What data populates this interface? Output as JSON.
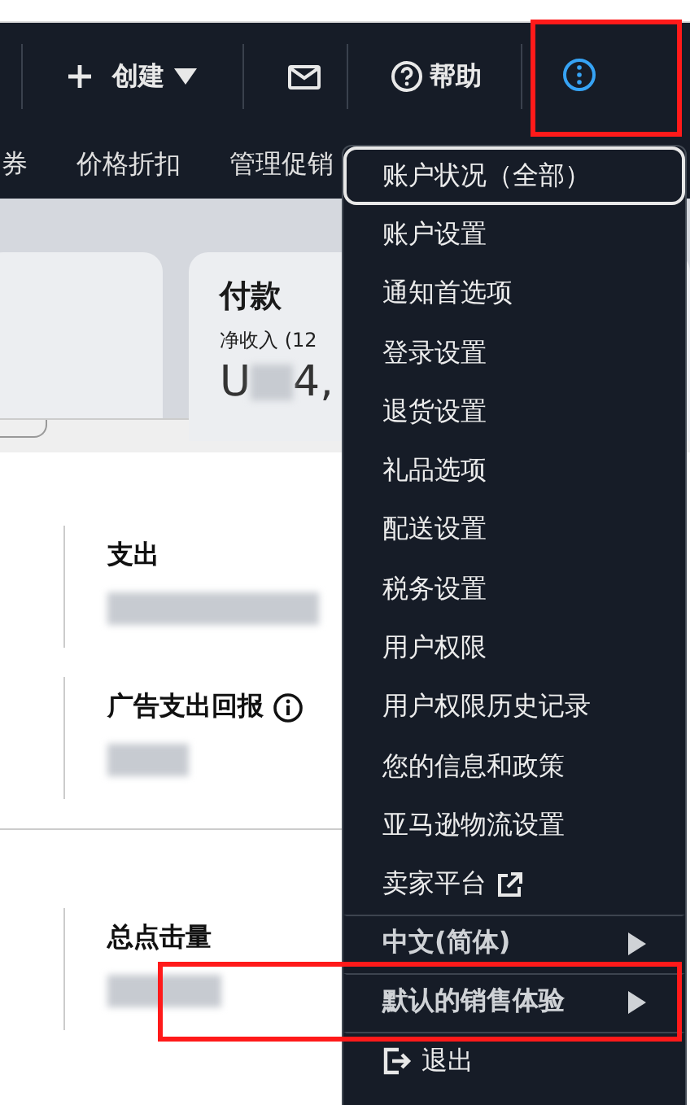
{
  "header": {
    "create_button": {
      "label": "创建"
    },
    "help_button": {
      "label": "帮助"
    },
    "info_button": {
      "highlighted": true
    }
  },
  "subnav": {
    "items": [
      {
        "label": "券"
      },
      {
        "label": "价格折扣"
      },
      {
        "label": "管理促销"
      }
    ]
  },
  "payment_card": {
    "title": "付款",
    "subtitle": "净收入 (12",
    "value_start": "U",
    "value_end": "4,"
  },
  "metrics": [
    {
      "label": "支出",
      "info": false,
      "divider_above": false
    },
    {
      "label": "广告支出回报",
      "info": true,
      "divider_above": false
    },
    {
      "label": "总点击量",
      "info": false,
      "divider_above": true
    }
  ],
  "menu": {
    "items": [
      {
        "label": "账户状况（全部）",
        "kind": "item",
        "selected": true,
        "divider_above": false,
        "highlighted": false
      },
      {
        "label": "账户设置",
        "kind": "item",
        "selected": false,
        "divider_above": false,
        "highlighted": false
      },
      {
        "label": "通知首选项",
        "kind": "item",
        "selected": false,
        "divider_above": false,
        "highlighted": false
      },
      {
        "label": "登录设置",
        "kind": "item",
        "selected": false,
        "divider_above": false,
        "highlighted": false
      },
      {
        "label": "退货设置",
        "kind": "item",
        "selected": false,
        "divider_above": false,
        "highlighted": false
      },
      {
        "label": "礼品选项",
        "kind": "item",
        "selected": false,
        "divider_above": false,
        "highlighted": false
      },
      {
        "label": "配送设置",
        "kind": "item",
        "selected": false,
        "divider_above": false,
        "highlighted": false
      },
      {
        "label": "税务设置",
        "kind": "item",
        "selected": false,
        "divider_above": false,
        "highlighted": false
      },
      {
        "label": "用户权限",
        "kind": "item",
        "selected": false,
        "divider_above": false,
        "highlighted": false
      },
      {
        "label": "用户权限历史记录",
        "kind": "item",
        "selected": false,
        "divider_above": false,
        "highlighted": false
      },
      {
        "label": "您的信息和政策",
        "kind": "item",
        "selected": false,
        "divider_above": false,
        "highlighted": false
      },
      {
        "label": "亚马逊物流设置",
        "kind": "item",
        "selected": false,
        "divider_above": false,
        "highlighted": false
      },
      {
        "label": "卖家平台",
        "kind": "external",
        "selected": false,
        "divider_above": false,
        "highlighted": false
      },
      {
        "label": "中文(简体)",
        "kind": "submenu",
        "selected": false,
        "divider_above": true,
        "highlighted": false
      },
      {
        "label": "默认的销售体验",
        "kind": "submenu",
        "selected": false,
        "divider_above": true,
        "highlighted": true
      },
      {
        "label": "退出",
        "kind": "logout",
        "selected": false,
        "divider_above": true,
        "highlighted": false
      }
    ]
  }
}
